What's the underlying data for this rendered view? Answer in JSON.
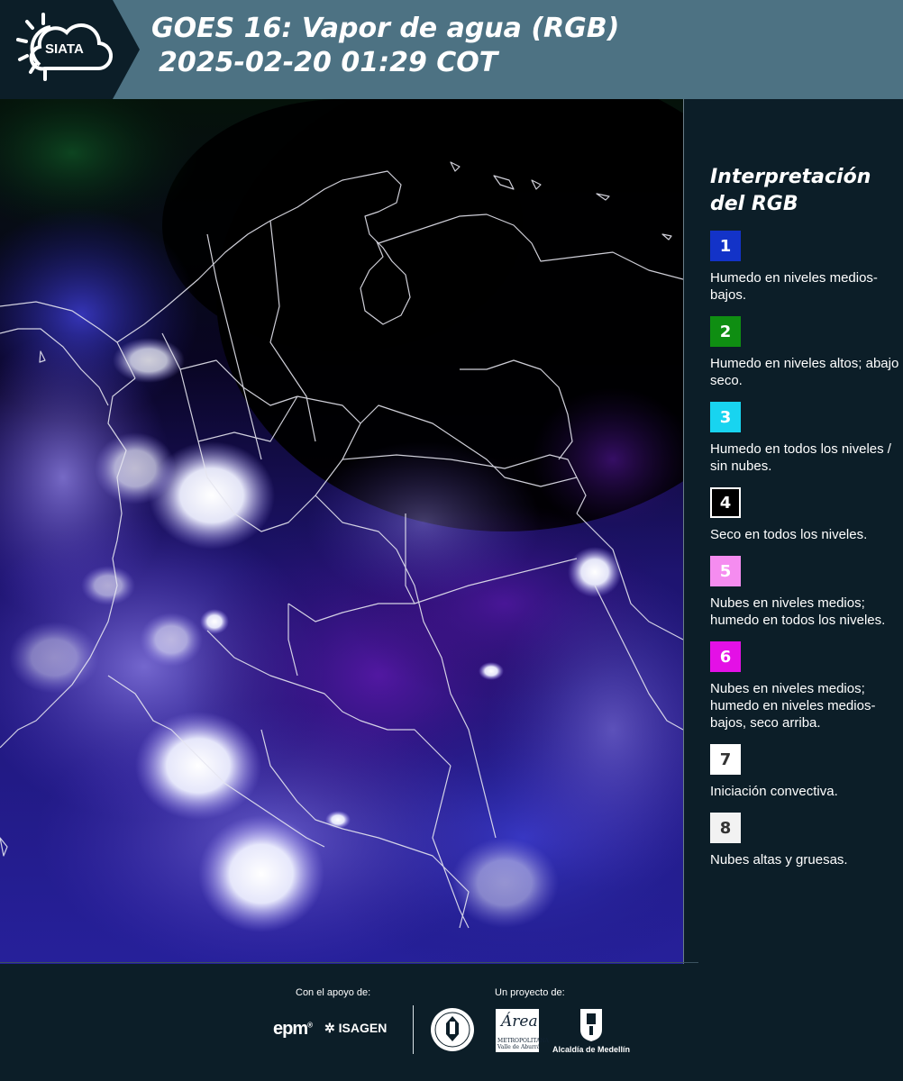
{
  "header": {
    "logo_text": "SIATA",
    "title_line1": "GOES 16: Vapor de agua (RGB)",
    "title_line2": "2025-02-20 01:29 COT"
  },
  "legend": {
    "title_line1": "Interpretación",
    "title_line2": "del RGB",
    "items": [
      {
        "number": "1",
        "color": "#1333c8",
        "text_color": "#ffffff",
        "label": "Humedo en niveles medios-bajos."
      },
      {
        "number": "2",
        "color": "#0f8e12",
        "text_color": "#ffffff",
        "label": "Humedo en niveles altos; abajo seco."
      },
      {
        "number": "3",
        "color": "#18d4f0",
        "text_color": "#ffffff",
        "label": "Humedo en todos los niveles / sin nubes."
      },
      {
        "number": "4",
        "color": "#000000",
        "text_color": "#ffffff",
        "label": "Seco en todos los niveles."
      },
      {
        "number": "5",
        "color": "#f58cf0",
        "text_color": "#ffffff",
        "label": "Nubes en niveles medios; humedo en todos los niveles."
      },
      {
        "number": "6",
        "color": "#e410e6",
        "text_color": "#ffffff",
        "label": "Nubes en niveles medios; humedo en niveles medios-bajos, seco arriba."
      },
      {
        "number": "7",
        "color": "#ffffff",
        "text_color": "#333333",
        "label": "Iniciación convectiva."
      },
      {
        "number": "8",
        "color": "#f2f2f2",
        "text_color": "#333333",
        "label": "Nubes altas y gruesas."
      }
    ]
  },
  "footer": {
    "support_label": "Con el apoyo de:",
    "project_label": "Un proyecto de:",
    "sponsor1": "epm",
    "sponsor2": "ISAGEN",
    "partner1_script": "Área",
    "partner1_text": "METROPOLITANA Valle de Aburrá",
    "partner2": "Alcaldía de Medellín"
  },
  "colors": {
    "header_bg": "#4d7283",
    "page_bg": "#0c1e28",
    "map_dry": "#000000",
    "map_moist": "#3a2fb0",
    "map_cloud": "#ffffff"
  }
}
